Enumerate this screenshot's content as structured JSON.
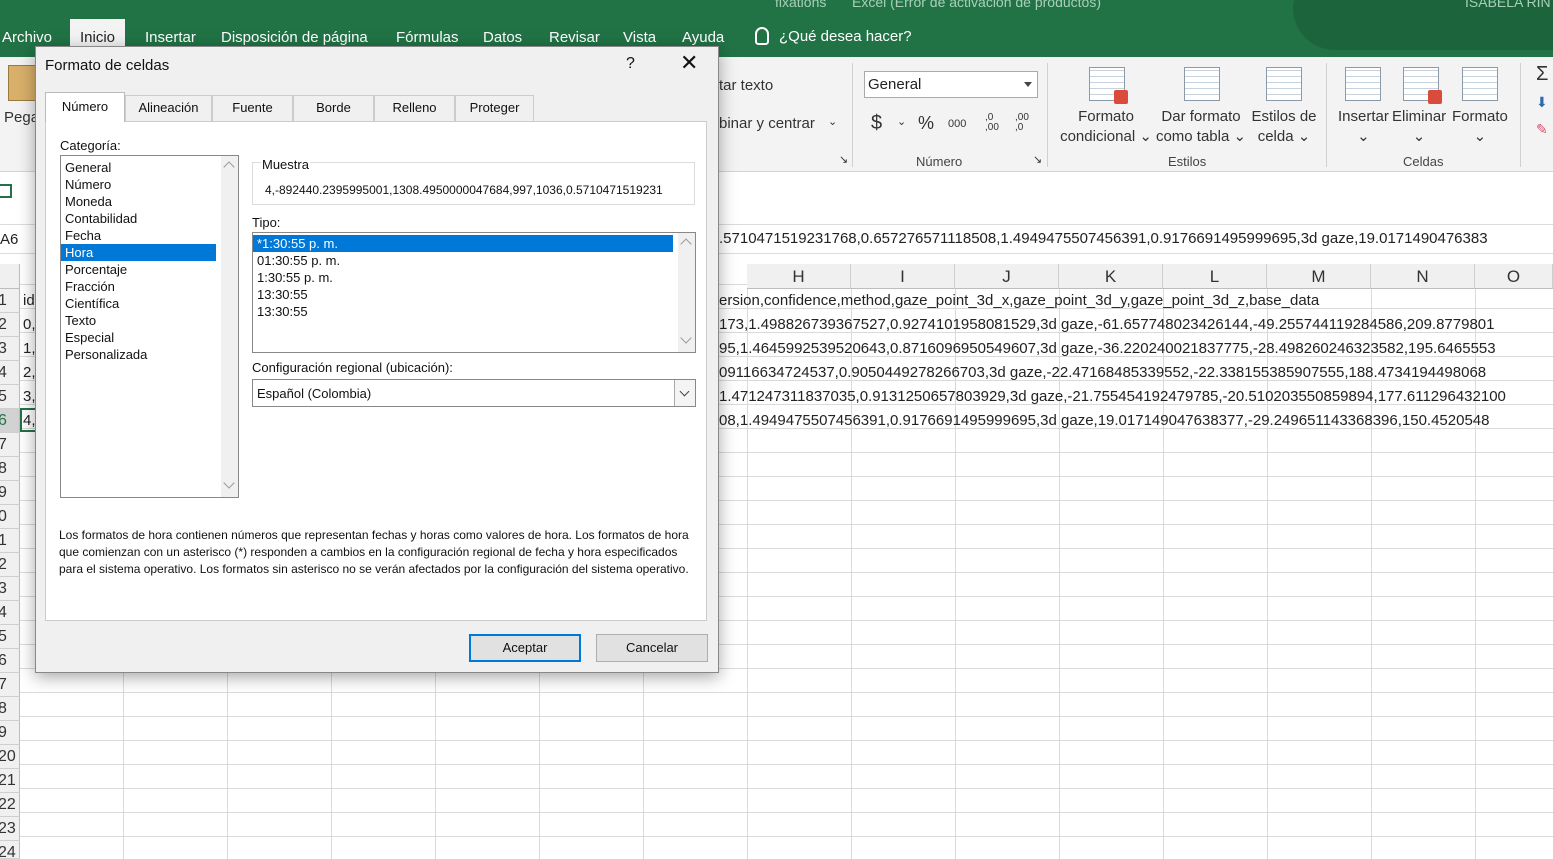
{
  "window": {
    "title_fragment_1": "fixations",
    "title_fragment_2": "Excel (Error de activación de productos)",
    "user": "ISABELA RIN"
  },
  "ribbon_tabs": [
    "Archivo",
    "Inicio",
    "Insertar",
    "Disposición de página",
    "Fórmulas",
    "Datos",
    "Revisar",
    "Vista",
    "Ayuda"
  ],
  "tell_me": "¿Qué desea hacer?",
  "ribbon": {
    "paste_label": "Pega",
    "wrap_text": "tar texto",
    "merge_center": "binar y centrar",
    "number_format": "General",
    "currency_symbol": "$",
    "percent_symbol": "%",
    "thousands": "000",
    "inc_decimal": ",0 ,00",
    "dec_decimal": ",00 ,0",
    "group_number": "Número",
    "group_styles": "Estilos",
    "group_cells": "Celdas",
    "cond_format": [
      "Formato",
      "condicional"
    ],
    "format_table": [
      "Dar formato",
      "como tabla"
    ],
    "cell_styles": [
      "Estilos de",
      "celda"
    ],
    "insert": "Insertar",
    "delete": "Eliminar",
    "format": "Formato",
    "sigma": "Σ"
  },
  "formula_bar": {
    "name_box": "A6",
    "content": ".5710471519231768,0.657276571118508,1.4949475507456391,0.9176691495999695,3d gaze,19.0171490476383"
  },
  "columns": [
    "H",
    "I",
    "J",
    "K",
    "L",
    "M",
    "N",
    "O"
  ],
  "rows": [
    "1",
    "2",
    "3",
    "4",
    "5",
    "6",
    "7",
    "8",
    "9",
    "0",
    "1",
    "2",
    "3",
    "4",
    "5",
    "6",
    "7",
    "8",
    "9",
    "20",
    "21",
    "22",
    "23",
    "24"
  ],
  "col_a_values": [
    "id",
    "0,",
    "1,",
    "2,",
    "3,",
    "4,"
  ],
  "row_texts": [
    "ersion,confidence,method,gaze_point_3d_x,gaze_point_3d_y,gaze_point_3d_z,base_data",
    "173,1.498826739367527,0.9274101958081529,3d gaze,-61.657748023426144,-49.255744119284586,209.8779801",
    "95,1.4645992539520643,0.8716096950549607,3d gaze,-36.220240021837775,-28.498260246323582,195.6465553",
    "09116634724537,0.9050449278266703,3d gaze,-22.47168485339552,-22.338155385907555,188.4734194498068",
    "1.471247311837035,0.9131250657803929,3d gaze,-21.755454192479785,-20.510203550859894,177.611296432100",
    "08,1.4949475507456391,0.9176691495999695,3d gaze,19.017149047638377,-29.249651143368396,150.4520548"
  ],
  "dialog": {
    "title": "Formato de celdas",
    "help": "?",
    "close": "✕",
    "tabs": [
      "Número",
      "Alineación",
      "Fuente",
      "Borde",
      "Relleno",
      "Proteger"
    ],
    "category_label": "Categoría:",
    "categories": [
      "General",
      "Número",
      "Moneda",
      "Contabilidad",
      "Fecha",
      "Hora",
      "Porcentaje",
      "Fracción",
      "Científica",
      "Texto",
      "Especial",
      "Personalizada"
    ],
    "selected_category": "Hora",
    "sample_label": "Muestra",
    "sample_value": "4,-892440.2395995001,1308.4950000047684,997,1036,0.5710471519231",
    "type_label": "Tipo:",
    "types": [
      "*1:30:55 p. m.",
      "01:30:55 p. m.",
      "1:30:55 p. m.",
      "13:30:55",
      "13:30:55"
    ],
    "locale_label": "Configuración regional (ubicación):",
    "locale_value": "Español (Colombia)",
    "description": "Los formatos de hora contienen números que representan fechas y horas como valores de hora. Los formatos de hora que comienzan con un asterisco (*) responden a cambios en la configuración regional de fecha y hora especificados para el sistema operativo. Los formatos sin asterisco no se verán afectados por la configuración del sistema operativo.",
    "ok": "Aceptar",
    "cancel": "Cancelar"
  },
  "colors": {
    "excel_green": "#217346",
    "selection_blue": "#0078d7"
  }
}
